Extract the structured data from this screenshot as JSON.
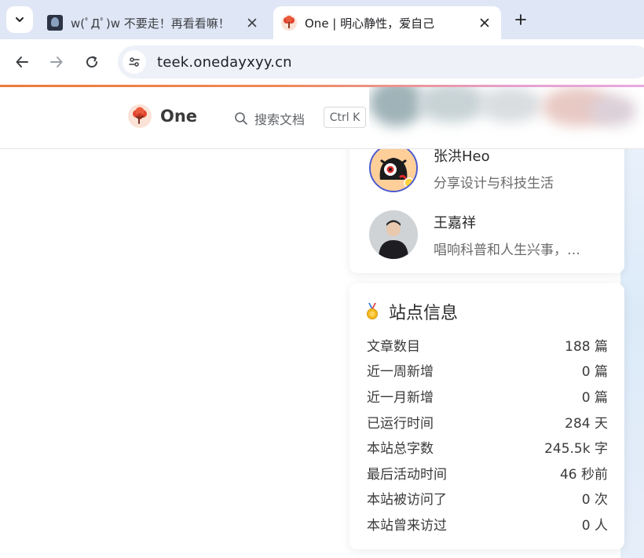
{
  "browser": {
    "tabs": [
      {
        "title": "w(ﾟДﾟ)w 不要走！再看看嘛！",
        "active": false
      },
      {
        "title": "One | 明心静性，爱自己",
        "active": true
      }
    ],
    "url": "teek.onedayxyy.cn"
  },
  "navbar": {
    "brand": "One",
    "search_label": "搜索文档",
    "search_shortcut": "Ctrl K"
  },
  "friends": [
    {
      "name": "张洪Heo",
      "desc": "分享设计与科技生活"
    },
    {
      "name": "王嘉祥",
      "desc": "唱响科普和人生兴事，…"
    }
  ],
  "site_info": {
    "title": "站点信息",
    "rows": [
      {
        "label": "文章数目",
        "value": "188 篇"
      },
      {
        "label": "近一周新增",
        "value": "0 篇"
      },
      {
        "label": "近一月新增",
        "value": "0 篇"
      },
      {
        "label": "已运行时间",
        "value": "284 天"
      },
      {
        "label": "本站总字数",
        "value": "245.5k 字"
      },
      {
        "label": "最后活动时间",
        "value": "46 秒前"
      },
      {
        "label": "本站被访问了",
        "value": "0 次"
      },
      {
        "label": "本站曾来访过",
        "value": "0 人"
      }
    ]
  },
  "colors": {
    "progress_start": "#ec7a3a",
    "progress_end": "#e8a8e0",
    "tabstrip": "#dfe6f5"
  }
}
